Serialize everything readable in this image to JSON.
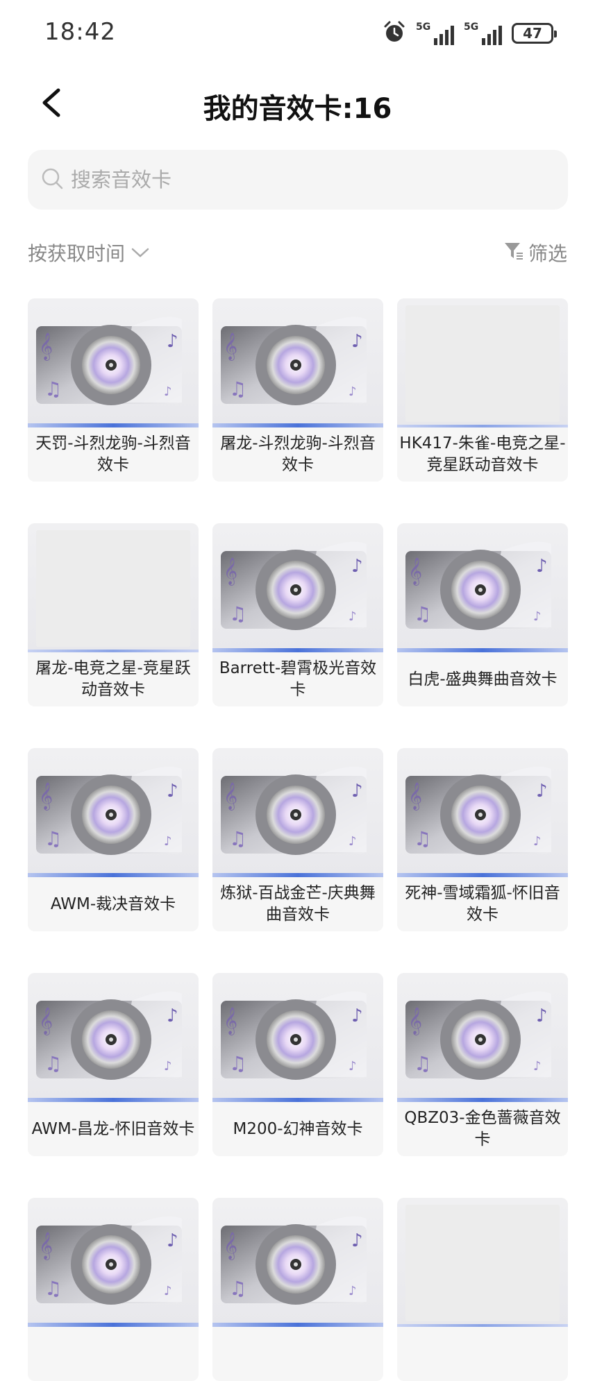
{
  "status_bar": {
    "time": "18:42",
    "network1": "5G",
    "network2": "5G",
    "battery": "47",
    "icons": [
      "alarm-icon",
      "signal-icon",
      "signal-icon",
      "battery-icon"
    ]
  },
  "header": {
    "title": "我的音效卡:16",
    "back_icon": "chevron-left-icon"
  },
  "search": {
    "placeholder": "搜索音效卡",
    "value": ""
  },
  "toolbar": {
    "sort_label": "按获取时间",
    "filter_label": "筛选"
  },
  "cards": [
    {
      "label": "天罚-斗烈龙驹-斗烈音效卡",
      "thumb": "disc"
    },
    {
      "label": "屠龙-斗烈龙驹-斗烈音效卡",
      "thumb": "disc"
    },
    {
      "label": "HK417-朱雀-电竞之星-竞星跃动音效卡",
      "thumb": "blank"
    },
    {
      "label": "屠龙-电竞之星-竞星跃动音效卡",
      "thumb": "blank"
    },
    {
      "label": "Barrett-碧霄极光音效卡",
      "thumb": "disc"
    },
    {
      "label": "白虎-盛典舞曲音效卡",
      "thumb": "disc"
    },
    {
      "label": "AWM-裁决音效卡",
      "thumb": "disc"
    },
    {
      "label": "炼狱-百战金芒-庆典舞曲音效卡",
      "thumb": "disc"
    },
    {
      "label": "死神-雪域霜狐-怀旧音效卡",
      "thumb": "disc"
    },
    {
      "label": "AWM-昌龙-怀旧音效卡",
      "thumb": "disc"
    },
    {
      "label": "M200-幻神音效卡",
      "thumb": "disc"
    },
    {
      "label": "QBZ03-金色蔷薇音效卡",
      "thumb": "disc"
    },
    {
      "label": "",
      "thumb": "disc"
    },
    {
      "label": "",
      "thumb": "disc"
    },
    {
      "label": "",
      "thumb": "blank"
    }
  ]
}
